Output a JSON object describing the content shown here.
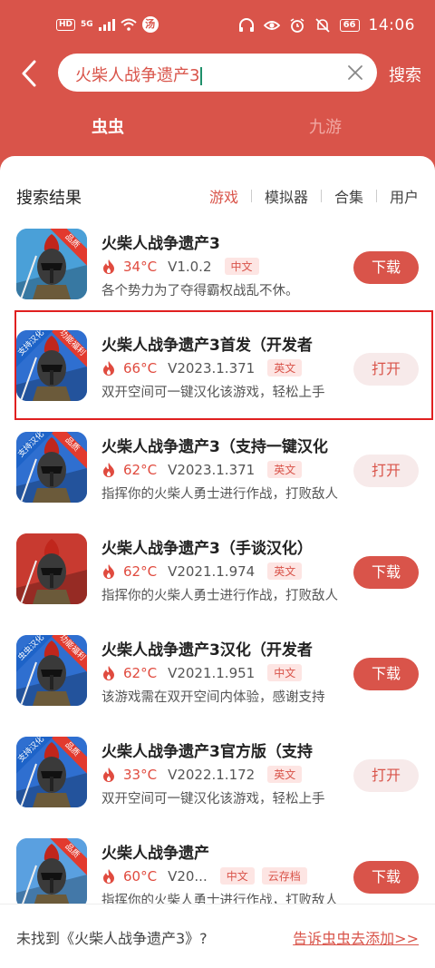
{
  "status_bar": {
    "hd": "HD",
    "network": "5G",
    "badge": "汤",
    "battery": "66",
    "time": "14:06"
  },
  "header": {
    "search_query": "火柴人战争遗产3",
    "search_button": "搜索"
  },
  "source_tabs": [
    {
      "label": "虫虫",
      "active": true
    },
    {
      "label": "九游",
      "active": false
    }
  ],
  "results": {
    "title": "搜索结果",
    "filters": [
      {
        "label": "游戏",
        "active": true
      },
      {
        "label": "模拟器",
        "active": false
      },
      {
        "label": "合集",
        "active": false
      },
      {
        "label": "用户",
        "active": false
      }
    ],
    "items": [
      {
        "name": "火柴人战争遗产3",
        "temp": "34°C",
        "version": "V1.0.2",
        "tags": [
          "中文"
        ],
        "desc": "各个势力为了夺得霸权战乱不休。",
        "button": "下载",
        "button_type": "download",
        "icon_bg": "#4aa0d8",
        "badge_text": "品质",
        "highlighted": false
      },
      {
        "name": "火柴人战争遗产3首发（开发者",
        "temp": "66°C",
        "version": "V2023.1.371",
        "tags": [
          "英文"
        ],
        "desc": "双开空间可一键汉化该游戏，轻松上手",
        "button": "打开",
        "button_type": "open",
        "icon_bg": "#2f6fd0",
        "badge_text": "功能福利",
        "badge_left": "支持汉化",
        "highlighted": true
      },
      {
        "name": "火柴人战争遗产3（支持一键汉化",
        "temp": "62°C",
        "version": "V2023.1.371",
        "tags": [
          "英文"
        ],
        "desc": "指挥你的火柴人勇士进行作战，打败敌人",
        "button": "打开",
        "button_type": "open",
        "icon_bg": "#2f6fd0",
        "badge_text": "品质",
        "badge_left": "支持汉化",
        "highlighted": false
      },
      {
        "name": "火柴人战争遗产3（手谈汉化）",
        "temp": "62°C",
        "version": "V2021.1.974",
        "tags": [
          "英文"
        ],
        "desc": "指挥你的火柴人勇士进行作战，打败敌人",
        "button": "下载",
        "button_type": "download",
        "icon_bg": "#c83a30",
        "highlighted": false
      },
      {
        "name": "火柴人战争遗产3汉化（开发者",
        "temp": "62°C",
        "version": "V2021.1.951",
        "tags": [
          "中文"
        ],
        "desc": "该游戏需在双开空间内体验，感谢支持",
        "button": "下载",
        "button_type": "download",
        "icon_bg": "#2f6fd0",
        "badge_text": "功能福利",
        "badge_left": "虫虫汉化",
        "highlighted": false
      },
      {
        "name": "火柴人战争遗产3官方版（支持",
        "temp": "33°C",
        "version": "V2022.1.172",
        "tags": [
          "英文"
        ],
        "desc": "双开空间可一键汉化该游戏，轻松上手",
        "button": "打开",
        "button_type": "open",
        "icon_bg": "#2f6fd0",
        "badge_text": "品质",
        "badge_left": "支持汉化",
        "highlighted": false
      },
      {
        "name": "火柴人战争遗产",
        "temp": "60°C",
        "version": "V20...",
        "tags": [
          "中文",
          "云存档"
        ],
        "desc": "指挥你的火柴人勇士进行作战，打败敌人",
        "button": "下载",
        "button_type": "download",
        "icon_bg": "#5aa0e0",
        "badge_text": "品质",
        "highlighted": false
      }
    ]
  },
  "footer": {
    "note": "未找到《火柴人战争遗产3》?",
    "link": "告诉虫虫去添加>>"
  },
  "colors": {
    "brand": "#d9544a",
    "tag_bg": "#fde5e3",
    "open_btn_bg": "#f7eaea",
    "highlight_border": "#e02020"
  }
}
